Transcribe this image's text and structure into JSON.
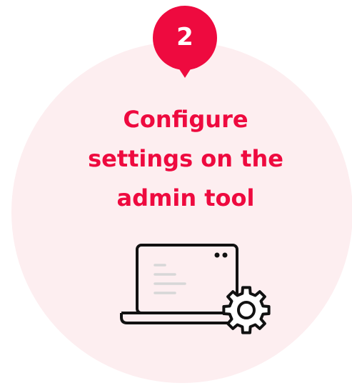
{
  "step": {
    "number": "2"
  },
  "title": {
    "lines": [
      "Configure",
      "settings on the",
      "admin tool"
    ]
  },
  "icon": {
    "name": "laptop-settings-icon"
  },
  "colors": {
    "accent": "#ee0a3f",
    "circle_background": "#fdeef0",
    "icon_stroke": "#111111"
  }
}
